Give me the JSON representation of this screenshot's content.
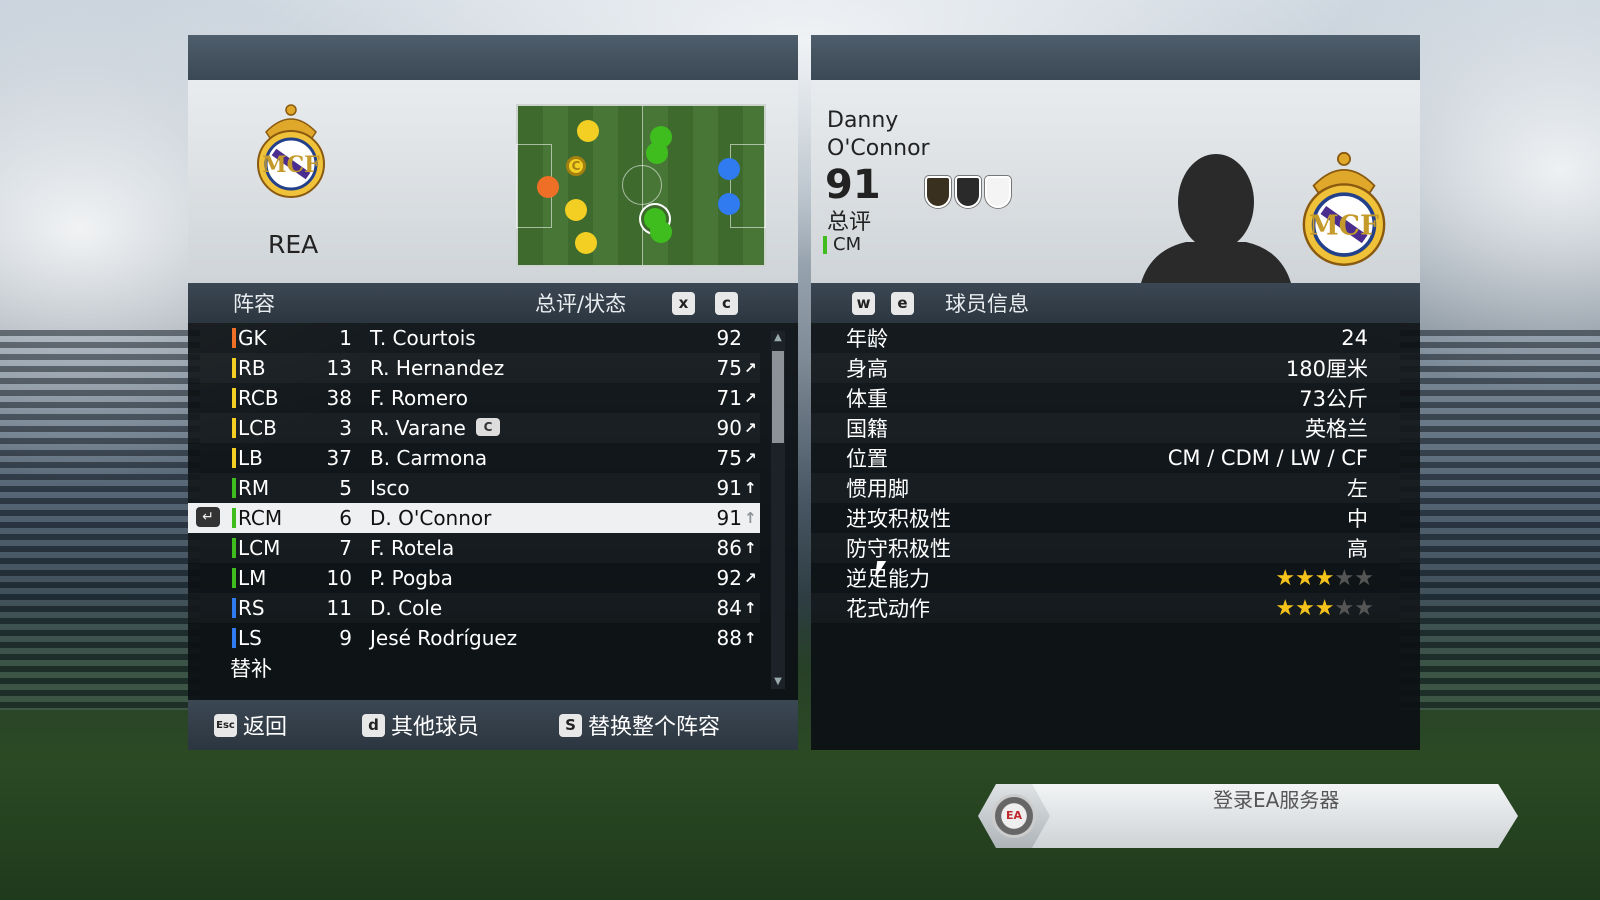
{
  "left": {
    "team_abbr": "REA",
    "roster_header": "阵容",
    "rating_header": "总评/状态",
    "key_x": "x",
    "key_c": "c",
    "players": [
      {
        "pos": "GK",
        "color": "#ef6f27",
        "num": "1",
        "name": "T. Courtois",
        "rating": "92",
        "arrow": ""
      },
      {
        "pos": "RB",
        "color": "#f2cf22",
        "num": "13",
        "name": "R. Hernandez",
        "rating": "75",
        "arrow": "↗"
      },
      {
        "pos": "RCB",
        "color": "#f2cf22",
        "num": "38",
        "name": "F. Romero",
        "rating": "71",
        "arrow": "↗"
      },
      {
        "pos": "LCB",
        "color": "#f2cf22",
        "num": "3",
        "name": "R. Varane",
        "rating": "90",
        "arrow": "↗"
      },
      {
        "pos": "LB",
        "color": "#f2cf22",
        "num": "37",
        "name": "B. Carmona",
        "rating": "75",
        "arrow": "↗"
      },
      {
        "pos": "RM",
        "color": "#3fbd1f",
        "num": "5",
        "name": "Isco",
        "rating": "91",
        "arrow": "↑"
      },
      {
        "pos": "RCM",
        "color": "#3fbd1f",
        "num": "6",
        "name": "D. O'Connor",
        "rating": "91",
        "arrow": "↑"
      },
      {
        "pos": "LCM",
        "color": "#3fbd1f",
        "num": "7",
        "name": "F. Rotela",
        "rating": "86",
        "arrow": "↑"
      },
      {
        "pos": "LM",
        "color": "#3fbd1f",
        "num": "10",
        "name": "P. Pogba",
        "rating": "92",
        "arrow": "↗"
      },
      {
        "pos": "RS",
        "color": "#2f7bef",
        "num": "11",
        "name": "D. Cole",
        "rating": "84",
        "arrow": "↑"
      },
      {
        "pos": "LS",
        "color": "#2f7bef",
        "num": "9",
        "name": "Jesé Rodríguez",
        "rating": "88",
        "arrow": "↑"
      }
    ],
    "subs_label": "替补",
    "bottom": {
      "esc_key": "Esc",
      "back": "返回",
      "d_key": "d",
      "other_players": "其他球员",
      "s_key": "S",
      "replace_all": "替换整个阵容"
    }
  },
  "right": {
    "first_name": "Danny",
    "last_name": "O'Connor",
    "overall": "91",
    "overall_label": "总评",
    "position": "CM",
    "info_header": "球员信息",
    "key_w": "w",
    "key_e": "e",
    "attributes": [
      {
        "label": "年龄",
        "value": "24"
      },
      {
        "label": "身高",
        "value": "180厘米"
      },
      {
        "label": "体重",
        "value": "73公斤"
      },
      {
        "label": "国籍",
        "value": "英格兰"
      },
      {
        "label": "位置",
        "value": "CM / CDM / LW / CF"
      },
      {
        "label": "惯用脚",
        "value": "左"
      },
      {
        "label": "进攻积极性",
        "value": "中"
      },
      {
        "label": "防守积极性",
        "value": "高"
      }
    ],
    "star_attrs": [
      {
        "label": "逆足能力",
        "stars": 3,
        "max": 5
      },
      {
        "label": "花式动作",
        "stars": 3,
        "max": 5
      }
    ]
  },
  "ea_login": {
    "text": "登录EA服务器",
    "logo": "EA"
  }
}
